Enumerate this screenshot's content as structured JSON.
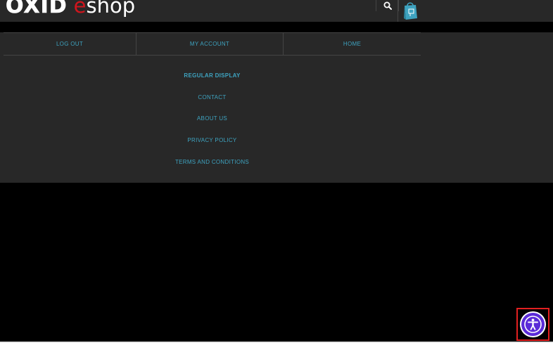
{
  "header": {
    "logo": {
      "brand": "OXID",
      "accent": "e",
      "product": "shop"
    },
    "search_icon": "search-icon",
    "cart_icon": "shopping-bag-icon"
  },
  "colors": {
    "header_bg": "#282828",
    "link": "#3ea3c0",
    "logo_accent": "#d0151d",
    "accessibility": "#5b2bd8",
    "highlight_border": "#e22020"
  },
  "nav": {
    "tabs": [
      {
        "label": "LOG OUT"
      },
      {
        "label": "MY ACCOUNT"
      },
      {
        "label": "HOME"
      }
    ],
    "links": [
      {
        "label": "REGULAR DISPLAY",
        "active": true
      },
      {
        "label": "CONTACT"
      },
      {
        "label": "ABOUT US"
      },
      {
        "label": "PRIVACY POLICY"
      },
      {
        "label": "TERMS AND CONDITIONS"
      }
    ]
  },
  "accessibility": {
    "icon": "accessibility-icon"
  }
}
